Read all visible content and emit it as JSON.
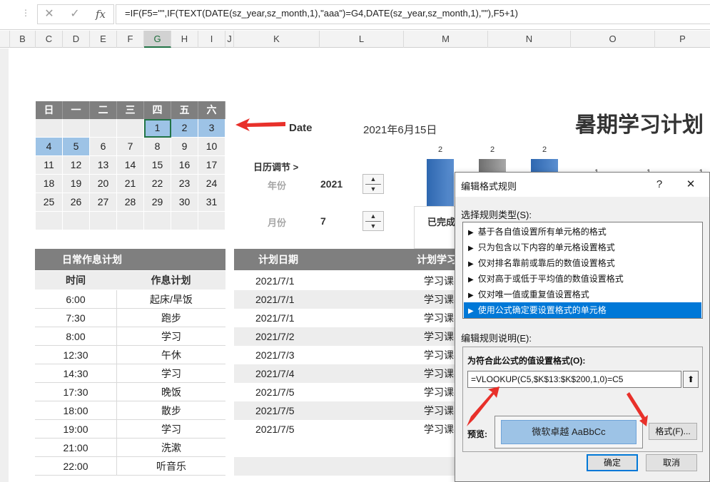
{
  "formula_bar": {
    "cancel_icon": "x-icon",
    "confirm_icon": "check-icon",
    "fx_label": "fx",
    "formula": "=IF(F5=\"\",IF(TEXT(DATE(sz_year,sz_month,1),\"aaa\")=G4,DATE(sz_year,sz_month,1),\"\"),F5+1)"
  },
  "columns": [
    "B",
    "C",
    "D",
    "E",
    "F",
    "G",
    "H",
    "I",
    "J",
    "K",
    "L",
    "M",
    "N",
    "O",
    "P"
  ],
  "active_column": "G",
  "calendar": {
    "weekdays": [
      "日",
      "一",
      "二",
      "三",
      "四",
      "五",
      "六"
    ],
    "rows": [
      [
        "",
        "",
        "",
        "",
        "1",
        "2",
        "3"
      ],
      [
        "4",
        "5",
        "6",
        "7",
        "8",
        "9",
        "10"
      ],
      [
        "11",
        "12",
        "13",
        "14",
        "15",
        "16",
        "17"
      ],
      [
        "18",
        "19",
        "20",
        "21",
        "22",
        "23",
        "24"
      ],
      [
        "25",
        "26",
        "27",
        "28",
        "29",
        "30",
        "31"
      ],
      [
        "",
        "",
        "",
        "",
        "",
        "",
        ""
      ]
    ],
    "highlighted": [
      "1",
      "2",
      "3",
      "4",
      "5"
    ],
    "selected_cell": "1"
  },
  "date_label": "Date",
  "date_value": "2021年6月15日",
  "page_title": "暑期学习计划",
  "calendar_adjust": {
    "label": "日历调节 >",
    "year_label": "年份",
    "year_value": "2021",
    "month_label": "月份",
    "month_value": "7"
  },
  "chart": {
    "bar_labels": [
      "2",
      "2",
      "2",
      "1",
      "1",
      "1"
    ],
    "completed_label": "已完成"
  },
  "daily_plan": {
    "title": "日常作息计划",
    "col_time": "时间",
    "col_plan": "作息计划",
    "rows": [
      {
        "time": "6:00",
        "plan": "起床/早饭"
      },
      {
        "time": "7:30",
        "plan": "跑步"
      },
      {
        "time": "8:00",
        "plan": "学习"
      },
      {
        "time": "12:30",
        "plan": "午休"
      },
      {
        "time": "14:30",
        "plan": "学习"
      },
      {
        "time": "17:30",
        "plan": "晚饭"
      },
      {
        "time": "18:00",
        "plan": "散步"
      },
      {
        "time": "19:00",
        "plan": "学习"
      },
      {
        "time": "21:00",
        "plan": "洗漱"
      },
      {
        "time": "22:00",
        "plan": "听音乐"
      }
    ]
  },
  "study_plan": {
    "col_date": "计划日期",
    "col_study": "计划学习",
    "rows": [
      {
        "date": "2021/7/1",
        "study": "学习课本"
      },
      {
        "date": "2021/7/1",
        "study": "学习课本"
      },
      {
        "date": "2021/7/1",
        "study": "学习课本"
      },
      {
        "date": "2021/7/2",
        "study": "学习课本"
      },
      {
        "date": "2021/7/3",
        "study": "学习课本"
      },
      {
        "date": "2021/7/4",
        "study": "学习课本"
      },
      {
        "date": "2021/7/5",
        "study": "学习课本"
      },
      {
        "date": "2021/7/5",
        "study": "学习课本"
      },
      {
        "date": "2021/7/5",
        "study": "学习课本"
      }
    ]
  },
  "dialog": {
    "title": "编辑格式规则",
    "help": "?",
    "close": "✕",
    "select_rule_type": "选择规则类型(S):",
    "rule_types": [
      "基于各自值设置所有单元格的格式",
      "只为包含以下内容的单元格设置格式",
      "仅对排名靠前或靠后的数值设置格式",
      "仅对高于或低于平均值的数值设置格式",
      "仅对唯一值或重复值设置格式",
      "使用公式确定要设置格式的单元格"
    ],
    "selected_rule_index": 5,
    "edit_rule_desc": "编辑规则说明(E):",
    "formula_heading": "为符合此公式的值设置格式(O):",
    "formula_value": "=VLOOKUP(C5,$K$13:$K$200,1,0)=C5",
    "preview_label": "预览:",
    "preview_text": "微软卓越  AaBbCc",
    "format_button": "格式(F)...",
    "ok_button": "确定",
    "cancel_button": "取消"
  },
  "colors": {
    "header_gray": "#7f7f7f",
    "highlight_blue": "#9dc3e6",
    "accent_red": "#e8302a",
    "selection_blue": "#0078d7"
  }
}
